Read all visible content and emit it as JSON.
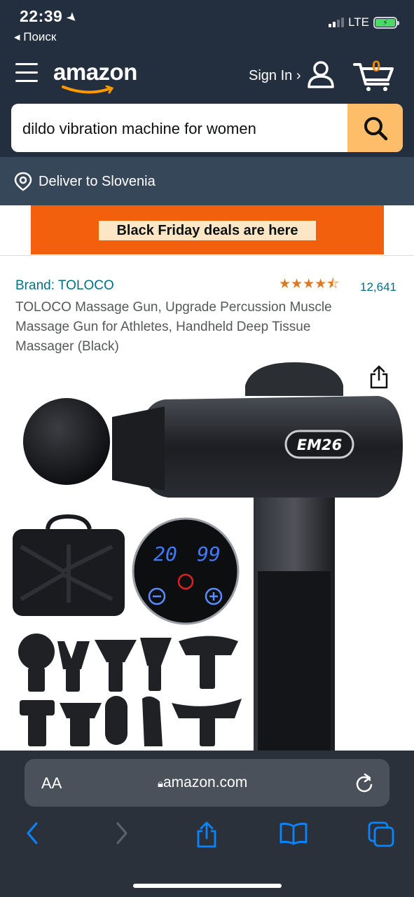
{
  "status": {
    "time": "22:39",
    "back_label": "◂ Поиск",
    "network": "LTE"
  },
  "header": {
    "logo_text": "amazon",
    "signin_label": "Sign In ›",
    "cart_count": "0"
  },
  "search": {
    "query": "dildo vibration machine for women"
  },
  "delivery": {
    "label": "Deliver to Slovenia"
  },
  "banner": {
    "label": "Black Friday deals are here"
  },
  "product": {
    "brand": "Brand: TOLOCO",
    "rating": 4.5,
    "reviews": "12,641",
    "title": "TOLOCO Massage Gun, Upgrade Percussion Muscle Massage Gun for Athletes, Handheld Deep Tissue Massager (Black)",
    "device_label": "EM26",
    "display_left": "20",
    "display_right": "99"
  },
  "browser": {
    "aa_label": "AA",
    "domain": "amazon.com"
  },
  "colors": {
    "header_bg": "#232f3e",
    "delivery_bg": "#37475a",
    "search_button": "#febd69",
    "banner_bg": "#f25f0d",
    "link": "#007185",
    "star": "#de7921",
    "safari_bg": "#2b313a",
    "safari_icon": "#0a84ff"
  }
}
